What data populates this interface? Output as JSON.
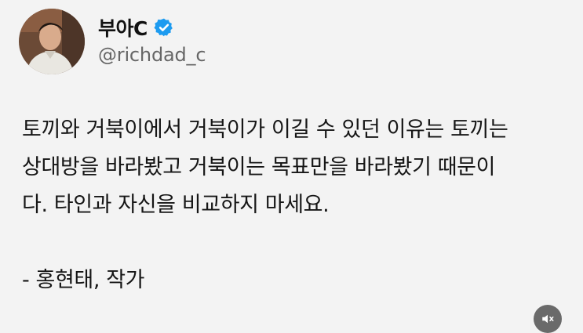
{
  "author": {
    "display_name": "부아C",
    "handle": "@richdad_c",
    "verified": true,
    "avatar_icon": "profile-photo",
    "verified_icon": "verified-badge-icon",
    "verified_color": "#1d9bf0"
  },
  "tweet": {
    "lines": [
      "토끼와 거북이에서 거북이가 이길 수 있던 이유는 토끼는",
      "상대방을 바라봤고 거북이는 목표만을 바라봤기 때문이",
      "다. 타인과 자신을 비교하지 마세요."
    ],
    "attribution": "- 홍현태, 작가"
  },
  "controls": {
    "mute_icon": "speaker-muted-icon"
  }
}
